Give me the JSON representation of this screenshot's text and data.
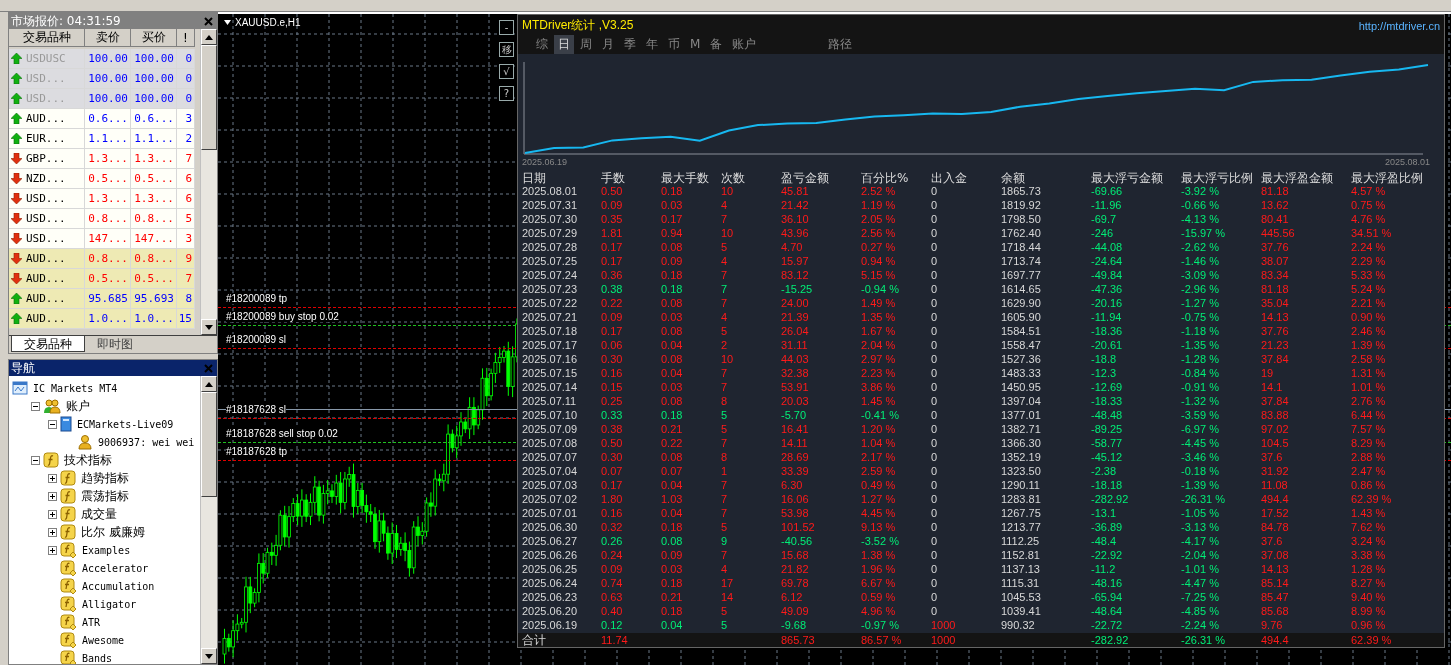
{
  "market_watch": {
    "title": "市场报价: 04:31:59",
    "columns": [
      "交易品种",
      "卖价",
      "买价",
      "!"
    ],
    "rows": [
      {
        "symbol": "USDUSC",
        "bid": "100.00",
        "ask": "100.00",
        "spread": "0",
        "up": true,
        "kind": "inactive"
      },
      {
        "symbol": "USD...",
        "bid": "100.00",
        "ask": "100.00",
        "spread": "0",
        "up": true,
        "kind": "inactive"
      },
      {
        "symbol": "USD...",
        "bid": "100.00",
        "ask": "100.00",
        "spread": "0",
        "up": true,
        "kind": "inactive"
      },
      {
        "symbol": "AUD...",
        "bid": "0.6...",
        "ask": "0.6...",
        "spread": "3",
        "up": true,
        "kind": "normal"
      },
      {
        "symbol": "EUR...",
        "bid": "1.1...",
        "ask": "1.1...",
        "spread": "2",
        "up": true,
        "kind": "normal"
      },
      {
        "symbol": "GBP...",
        "bid": "1.3...",
        "ask": "1.3...",
        "spread": "7",
        "up": false,
        "kind": "normal"
      },
      {
        "symbol": "NZD...",
        "bid": "0.5...",
        "ask": "0.5...",
        "spread": "6",
        "up": false,
        "kind": "normal"
      },
      {
        "symbol": "USD...",
        "bid": "1.3...",
        "ask": "1.3...",
        "spread": "6",
        "up": false,
        "kind": "normal"
      },
      {
        "symbol": "USD...",
        "bid": "0.8...",
        "ask": "0.8...",
        "spread": "5",
        "up": false,
        "kind": "normal"
      },
      {
        "symbol": "USD...",
        "bid": "147...",
        "ask": "147...",
        "spread": "3",
        "up": false,
        "kind": "normal"
      },
      {
        "symbol": "AUD...",
        "bid": "0.8...",
        "ask": "0.8...",
        "spread": "9",
        "up": false,
        "kind": "highlighted"
      },
      {
        "symbol": "AUD...",
        "bid": "0.5...",
        "ask": "0.5...",
        "spread": "7",
        "up": false,
        "kind": "highlighted"
      },
      {
        "symbol": "AUD...",
        "bid": "95.685",
        "ask": "95.693",
        "spread": "8",
        "up": true,
        "kind": "highlighted"
      },
      {
        "symbol": "AUD...",
        "bid": "1.0...",
        "ask": "1.0...",
        "spread": "15",
        "up": true,
        "kind": "highlighted"
      }
    ],
    "tabs": [
      {
        "label": "交易品种",
        "selected": true
      },
      {
        "label": "即时图",
        "selected": false
      }
    ]
  },
  "navigator": {
    "title": "导航",
    "tree": [
      {
        "label": "IC Markets MT4",
        "kind": "terminal",
        "children": [
          {
            "label": "账户",
            "kind": "accounts",
            "expanded": true,
            "children": [
              {
                "label": "ECMarkets-Live09",
                "kind": "server",
                "expanded": true,
                "children": [
                  {
                    "label": "9006937: wei wei",
                    "kind": "user"
                  }
                ]
              }
            ]
          },
          {
            "label": "技术指标",
            "kind": "folder",
            "expanded": true,
            "children": [
              {
                "label": "趋势指标",
                "kind": "folder",
                "expanded": false
              },
              {
                "label": "震荡指标",
                "kind": "folder",
                "expanded": false
              },
              {
                "label": "成交量",
                "kind": "folder",
                "expanded": false
              },
              {
                "label": "比尔 威廉姆",
                "kind": "folder",
                "expanded": false
              },
              {
                "label": "Examples",
                "kind": "indicator",
                "expanded": false
              },
              {
                "label": "Accelerator",
                "kind": "indicator"
              },
              {
                "label": "Accumulation",
                "kind": "indicator"
              },
              {
                "label": "Alligator",
                "kind": "indicator"
              },
              {
                "label": "ATR",
                "kind": "indicator"
              },
              {
                "label": "Awesome",
                "kind": "indicator"
              },
              {
                "label": "Bands",
                "kind": "indicator"
              }
            ]
          }
        ]
      }
    ]
  },
  "chart": {
    "title": "XAUUSD.e,H1",
    "buttons": [
      "-",
      "移",
      "√",
      "?"
    ],
    "orders": [
      {
        "label": "#18200089 tp",
        "kind": "tp"
      },
      {
        "label": "#18200089 buy stop 0.02",
        "kind": "entry"
      },
      {
        "label": "#18200089 sl",
        "kind": "sl"
      },
      {
        "label": "#18187628 sl",
        "kind": "sl"
      },
      {
        "label": "#18187628 sell stop 0.02",
        "kind": "entry"
      },
      {
        "label": "#18187628 tp",
        "kind": "tp"
      }
    ]
  },
  "stats": {
    "title": "MTDriver统计 ,V3.25",
    "link": "http://mtdriver.cn",
    "tabs": [
      {
        "label": "综",
        "selected": false
      },
      {
        "label": "日",
        "selected": true
      },
      {
        "label": "周",
        "selected": false
      },
      {
        "label": "月",
        "selected": false
      },
      {
        "label": "季",
        "selected": false
      },
      {
        "label": "年",
        "selected": false
      },
      {
        "label": "币",
        "selected": false
      },
      {
        "label": "M",
        "selected": false
      },
      {
        "label": "备",
        "selected": false
      },
      {
        "label": "账户",
        "selected": false
      }
    ],
    "path_button": "路径",
    "equity_chart": {
      "start_label": "2025.06.19",
      "end_label": "2025.08.01"
    },
    "columns": [
      "日期",
      "手数",
      "最大手数",
      "次数",
      "盈亏金额",
      "百分比%",
      "出入金",
      "余额",
      "最大浮亏金额",
      "最大浮亏比例",
      "最大浮盈金额",
      "最大浮盈比例"
    ],
    "rows": [
      {
        "cells": [
          "2025.08.01",
          "0.50",
          "0.18",
          "10",
          "45.81",
          "2.52 %",
          "0",
          "1865.73",
          "-69.66",
          "-3.92 %",
          "81.18",
          "4.57 %"
        ],
        "loss": false,
        "deposit": false
      },
      {
        "cells": [
          "2025.07.31",
          "0.09",
          "0.03",
          "4",
          "21.42",
          "1.19 %",
          "0",
          "1819.92",
          "-11.96",
          "-0.66 %",
          "13.62",
          "0.75 %"
        ],
        "loss": false,
        "deposit": false
      },
      {
        "cells": [
          "2025.07.30",
          "0.35",
          "0.17",
          "7",
          "36.10",
          "2.05 %",
          "0",
          "1798.50",
          "-69.7",
          "-4.13 %",
          "80.41",
          "4.76 %"
        ],
        "loss": false,
        "deposit": false
      },
      {
        "cells": [
          "2025.07.29",
          "1.81",
          "0.94",
          "10",
          "43.96",
          "2.56 %",
          "0",
          "1762.40",
          "-246",
          "-15.97 %",
          "445.56",
          "34.51 %"
        ],
        "loss": false,
        "deposit": false
      },
      {
        "cells": [
          "2025.07.28",
          "0.17",
          "0.08",
          "5",
          "4.70",
          "0.27 %",
          "0",
          "1718.44",
          "-44.08",
          "-2.62 %",
          "37.76",
          "2.24 %"
        ],
        "loss": false,
        "deposit": false
      },
      {
        "cells": [
          "2025.07.25",
          "0.17",
          "0.09",
          "4",
          "15.97",
          "0.94 %",
          "0",
          "1713.74",
          "-24.64",
          "-1.46 %",
          "38.07",
          "2.29 %"
        ],
        "loss": false,
        "deposit": false
      },
      {
        "cells": [
          "2025.07.24",
          "0.36",
          "0.18",
          "7",
          "83.12",
          "5.15 %",
          "0",
          "1697.77",
          "-49.84",
          "-3.09 %",
          "83.34",
          "5.33 %"
        ],
        "loss": false,
        "deposit": false
      },
      {
        "cells": [
          "2025.07.23",
          "0.38",
          "0.18",
          "7",
          "-15.25",
          "-0.94 %",
          "0",
          "1614.65",
          "-47.36",
          "-2.96 %",
          "81.18",
          "5.24 %"
        ],
        "loss": true,
        "deposit": false
      },
      {
        "cells": [
          "2025.07.22",
          "0.22",
          "0.08",
          "7",
          "24.00",
          "1.49 %",
          "0",
          "1629.90",
          "-20.16",
          "-1.27 %",
          "35.04",
          "2.21 %"
        ],
        "loss": false,
        "deposit": false
      },
      {
        "cells": [
          "2025.07.21",
          "0.09",
          "0.03",
          "4",
          "21.39",
          "1.35 %",
          "0",
          "1605.90",
          "-11.94",
          "-0.75 %",
          "14.13",
          "0.90 %"
        ],
        "loss": false,
        "deposit": false
      },
      {
        "cells": [
          "2025.07.18",
          "0.17",
          "0.08",
          "5",
          "26.04",
          "1.67 %",
          "0",
          "1584.51",
          "-18.36",
          "-1.18 %",
          "37.76",
          "2.46 %"
        ],
        "loss": false,
        "deposit": false
      },
      {
        "cells": [
          "2025.07.17",
          "0.06",
          "0.04",
          "2",
          "31.11",
          "2.04 %",
          "0",
          "1558.47",
          "-20.61",
          "-1.35 %",
          "21.23",
          "1.39 %"
        ],
        "loss": false,
        "deposit": false
      },
      {
        "cells": [
          "2025.07.16",
          "0.30",
          "0.08",
          "10",
          "44.03",
          "2.97 %",
          "0",
          "1527.36",
          "-18.8",
          "-1.28 %",
          "37.84",
          "2.58 %"
        ],
        "loss": false,
        "deposit": false
      },
      {
        "cells": [
          "2025.07.15",
          "0.16",
          "0.04",
          "7",
          "32.38",
          "2.23 %",
          "0",
          "1483.33",
          "-12.3",
          "-0.84 %",
          "19",
          "1.31 %"
        ],
        "loss": false,
        "deposit": false
      },
      {
        "cells": [
          "2025.07.14",
          "0.15",
          "0.03",
          "7",
          "53.91",
          "3.86 %",
          "0",
          "1450.95",
          "-12.69",
          "-0.91 %",
          "14.1",
          "1.01 %"
        ],
        "loss": false,
        "deposit": false
      },
      {
        "cells": [
          "2025.07.11",
          "0.25",
          "0.08",
          "8",
          "20.03",
          "1.45 %",
          "0",
          "1397.04",
          "-18.33",
          "-1.32 %",
          "37.84",
          "2.76 %"
        ],
        "loss": false,
        "deposit": false
      },
      {
        "cells": [
          "2025.07.10",
          "0.33",
          "0.18",
          "5",
          "-5.70",
          "-0.41 %",
          "0",
          "1377.01",
          "-48.48",
          "-3.59 %",
          "83.88",
          "6.44 %"
        ],
        "loss": true,
        "deposit": false
      },
      {
        "cells": [
          "2025.07.09",
          "0.38",
          "0.21",
          "5",
          "16.41",
          "1.20 %",
          "0",
          "1382.71",
          "-89.25",
          "-6.97 %",
          "97.02",
          "7.57 %"
        ],
        "loss": false,
        "deposit": false
      },
      {
        "cells": [
          "2025.07.08",
          "0.50",
          "0.22",
          "7",
          "14.11",
          "1.04 %",
          "0",
          "1366.30",
          "-58.77",
          "-4.45 %",
          "104.5",
          "8.29 %"
        ],
        "loss": false,
        "deposit": false
      },
      {
        "cells": [
          "2025.07.07",
          "0.30",
          "0.08",
          "8",
          "28.69",
          "2.17 %",
          "0",
          "1352.19",
          "-45.12",
          "-3.46 %",
          "37.6",
          "2.88 %"
        ],
        "loss": false,
        "deposit": false
      },
      {
        "cells": [
          "2025.07.04",
          "0.07",
          "0.07",
          "1",
          "33.39",
          "2.59 %",
          "0",
          "1323.50",
          "-2.38",
          "-0.18 %",
          "31.92",
          "2.47 %"
        ],
        "loss": false,
        "deposit": false
      },
      {
        "cells": [
          "2025.07.03",
          "0.17",
          "0.04",
          "7",
          "6.30",
          "0.49 %",
          "0",
          "1290.11",
          "-18.18",
          "-1.39 %",
          "11.08",
          "0.86 %"
        ],
        "loss": false,
        "deposit": false
      },
      {
        "cells": [
          "2025.07.02",
          "1.80",
          "1.03",
          "7",
          "16.06",
          "1.27 %",
          "0",
          "1283.81",
          "-282.92",
          "-26.31 %",
          "494.4",
          "62.39 %"
        ],
        "loss": false,
        "deposit": false
      },
      {
        "cells": [
          "2025.07.01",
          "0.16",
          "0.04",
          "7",
          "53.98",
          "4.45 %",
          "0",
          "1267.75",
          "-13.1",
          "-1.05 %",
          "17.52",
          "1.43 %"
        ],
        "loss": false,
        "deposit": false
      },
      {
        "cells": [
          "2025.06.30",
          "0.32",
          "0.18",
          "5",
          "101.52",
          "9.13 %",
          "0",
          "1213.77",
          "-36.89",
          "-3.13 %",
          "84.78",
          "7.62 %"
        ],
        "loss": false,
        "deposit": false
      },
      {
        "cells": [
          "2025.06.27",
          "0.26",
          "0.08",
          "9",
          "-40.56",
          "-3.52 %",
          "0",
          "1112.25",
          "-48.4",
          "-4.17 %",
          "37.6",
          "3.24 %"
        ],
        "loss": true,
        "deposit": false
      },
      {
        "cells": [
          "2025.06.26",
          "0.24",
          "0.09",
          "7",
          "15.68",
          "1.38 %",
          "0",
          "1152.81",
          "-22.92",
          "-2.04 %",
          "37.08",
          "3.38 %"
        ],
        "loss": false,
        "deposit": false
      },
      {
        "cells": [
          "2025.06.25",
          "0.09",
          "0.03",
          "4",
          "21.82",
          "1.96 %",
          "0",
          "1137.13",
          "-11.2",
          "-1.01 %",
          "14.13",
          "1.28 %"
        ],
        "loss": false,
        "deposit": false
      },
      {
        "cells": [
          "2025.06.24",
          "0.74",
          "0.18",
          "17",
          "69.78",
          "6.67 %",
          "0",
          "1115.31",
          "-48.16",
          "-4.47 %",
          "85.14",
          "8.27 %"
        ],
        "loss": false,
        "deposit": false
      },
      {
        "cells": [
          "2025.06.23",
          "0.63",
          "0.21",
          "14",
          "6.12",
          "0.59 %",
          "0",
          "1045.53",
          "-65.94",
          "-7.25 %",
          "85.47",
          "9.40 %"
        ],
        "loss": false,
        "deposit": false
      },
      {
        "cells": [
          "2025.06.20",
          "0.40",
          "0.18",
          "5",
          "49.09",
          "4.96 %",
          "0",
          "1039.41",
          "-48.64",
          "-4.85 %",
          "85.68",
          "8.99 %"
        ],
        "loss": false,
        "deposit": false
      },
      {
        "cells": [
          "2025.06.19",
          "0.12",
          "0.04",
          "5",
          "-9.68",
          "-0.97 %",
          "1000",
          "990.32",
          "-22.72",
          "-2.24 %",
          "9.76",
          "0.96 %"
        ],
        "loss": true,
        "deposit": true
      }
    ],
    "total": {
      "label": "合计",
      "lots": "11.74",
      "pnl": "865.73",
      "pct": "86.57 %",
      "deposit": "1000",
      "max_dd": "-282.92",
      "max_dd_pct": "-26.31 %",
      "max_fp": "494.4",
      "max_fp_pct": "62.39 %"
    }
  }
}
